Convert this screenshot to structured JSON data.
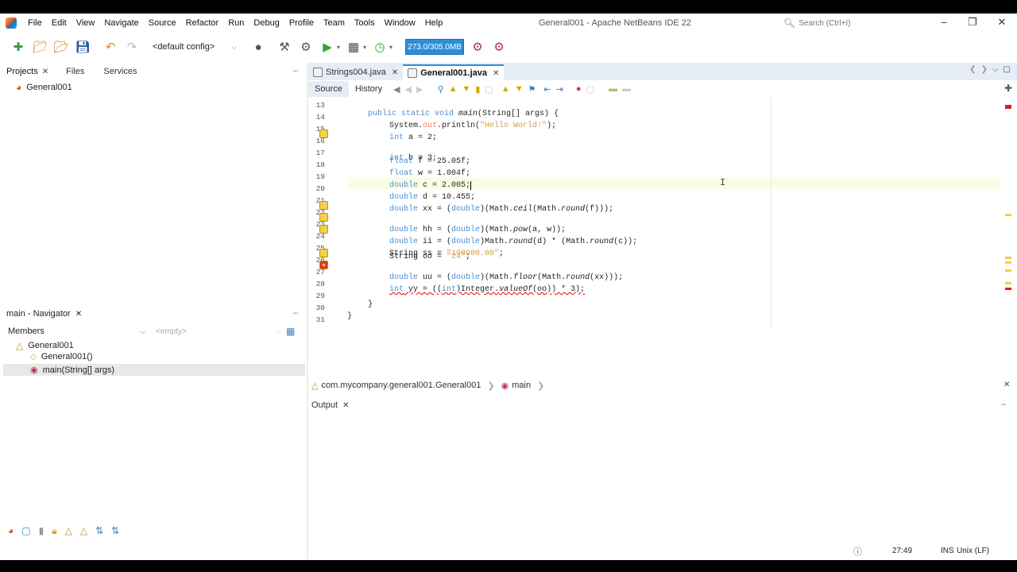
{
  "window": {
    "title": "General001 - Apache NetBeans IDE 22",
    "controls": [
      "minimize",
      "restore",
      "close"
    ]
  },
  "menu": [
    "File",
    "Edit",
    "View",
    "Navigate",
    "Source",
    "Refactor",
    "Run",
    "Debug",
    "Profile",
    "Team",
    "Tools",
    "Window",
    "Help"
  ],
  "search": {
    "placeholder": "Search (Ctrl+I)"
  },
  "toolbar": {
    "config": "<default config>",
    "memory": "273.0/305.0MB"
  },
  "projects_panel": {
    "tabs": [
      "Projects",
      "Files",
      "Services"
    ],
    "tree": [
      "General001"
    ]
  },
  "navigator": {
    "title": "main - Navigator",
    "members_label": "Members",
    "filter_placeholder": "<empty>",
    "items": [
      "General001",
      "General001()",
      "main(String[] args)"
    ]
  },
  "editor": {
    "tabs": [
      "Strings004.java",
      "General001.java"
    ],
    "active_tab": "General001.java",
    "view_tabs": [
      "Source",
      "History"
    ],
    "lines": [
      {
        "n": "13",
        "text": "public static void main(String[] args) {"
      },
      {
        "n": "14",
        "text": "System.out.println(\"Hello World!\");"
      },
      {
        "n": "15",
        "text": "int a = 2;"
      },
      {
        "n": "16",
        "text": "int b = 3;"
      },
      {
        "n": "17",
        "text": "float f = 25.05f;"
      },
      {
        "n": "18",
        "text": "float w = 1.004f;"
      },
      {
        "n": "19",
        "text": "double c = 2.005;"
      },
      {
        "n": "20",
        "text": "double d = 10.455;"
      },
      {
        "n": "21",
        "text": "double xx = (double)(Math.ceil(Math.round(f)));"
      },
      {
        "n": "22",
        "text": "double hh = (double)(Math.pow(a, w));"
      },
      {
        "n": "23",
        "text": "double ii = (double)Math.round(d) * (Math.round(c));"
      },
      {
        "n": "24",
        "text": "String ss = \"100000.00\";"
      },
      {
        "n": "25",
        "text": "String oo = \"24\";"
      },
      {
        "n": "26",
        "text": "double uu = (double)(Math.floor(Math.round(xx)));"
      },
      {
        "n": "27",
        "text": "int yy = ((int)Integer.valueOf(oo)) * 3);"
      },
      {
        "n": "28",
        "text": ""
      },
      {
        "n": "29",
        "text": "}"
      },
      {
        "n": "30",
        "text": "}"
      },
      {
        "n": "31",
        "text": ""
      }
    ]
  },
  "breadcrumb": [
    "com.mycompany.general001.General001",
    "main"
  ],
  "output": {
    "tab": "Output"
  },
  "status": {
    "position": "27:49",
    "mode": "INS",
    "line_endings": "Unix (LF)"
  }
}
